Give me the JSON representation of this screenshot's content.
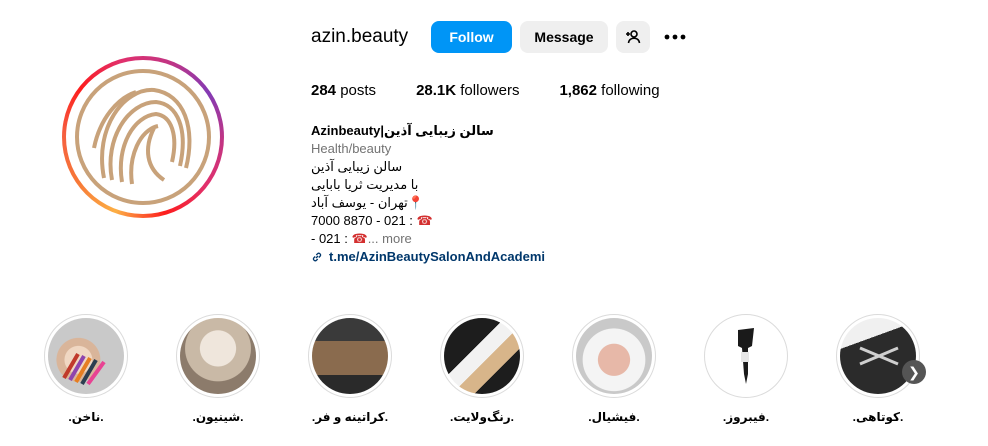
{
  "profile": {
    "username": "azin.beauty",
    "follow_label": "Follow",
    "message_label": "Message",
    "stats": {
      "posts_value": "284",
      "posts_label": "posts",
      "followers_value": "28.1K",
      "followers_label": "followers",
      "following_value": "1,862",
      "following_label": "following"
    },
    "bio": {
      "name": "Azinbeauty|سالن زیبایی آذین",
      "category": "Health/beauty",
      "line1": "سالن زیبایی آذین",
      "line2": "با مدیریت ثریا بابایی",
      "line3": "تهران - یوسف آباد",
      "line4": "7000 8870 - 021 :",
      "line5": "- 021 :",
      "more_label": "... more",
      "link": "t.me/AzinBeautySalonAndAcademi"
    }
  },
  "highlights": [
    {
      "label": ".ناخن."
    },
    {
      "label": ".شینیون."
    },
    {
      "label": ".کراتینه و فر."
    },
    {
      "label": ".رنگ‌ولایت."
    },
    {
      "label": ".فیشیال."
    },
    {
      "label": ".فیبروز."
    },
    {
      "label": ".کوتاهی."
    }
  ],
  "colors": {
    "follow_bg": "#0095f6",
    "secondary_bg": "#efefef",
    "link": "#00376b",
    "muted": "#737373",
    "logo_gold": "#c8a27a"
  }
}
